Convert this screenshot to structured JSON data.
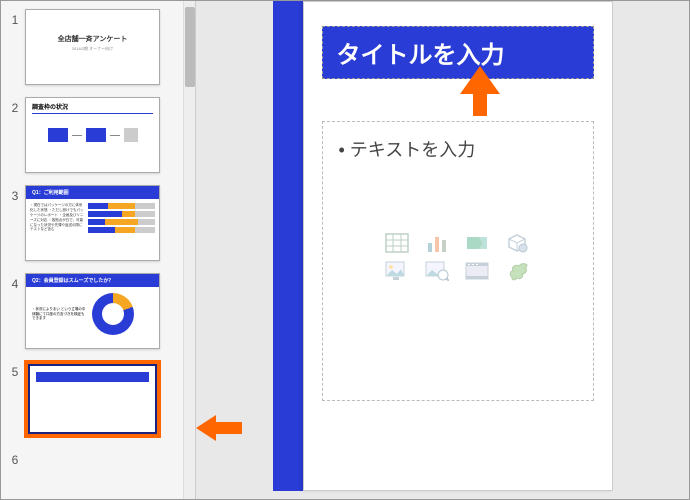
{
  "thumbs": [
    {
      "num": "1",
      "title": "全店舗一斉アンケート",
      "sub": "2016/2期 オーナー向け"
    },
    {
      "num": "2",
      "head": "調査枠の状況"
    },
    {
      "num": "3",
      "head": "Q1：ご利用範囲",
      "bullets": "・現在ではパッケージの方に体系化した状態\n・ただし設けでもパッケージのレポート\n・企画及びリニーズに対応\n・各拠点が日で、可能になった状況や先課や返送の際にテストなど含む"
    },
    {
      "num": "4",
      "head": "Q2：会員登録はスムーズでしたか？",
      "bullets": "・状況によりまい という立場の中体験にて口座の方言づきを検証もできます"
    },
    {
      "num": "5"
    },
    {
      "num": "6"
    }
  ],
  "slide": {
    "title_placeholder": "タイトルを入力",
    "content_placeholder": "• テキストを入力"
  },
  "icons": {
    "table": "table-icon",
    "chart": "chart-icon",
    "smartart": "smartart-icon",
    "object3d": "object3d-icon",
    "picture": "picture-icon",
    "online_picture": "online-picture-icon",
    "video": "video-icon",
    "bird": "online-icon"
  }
}
